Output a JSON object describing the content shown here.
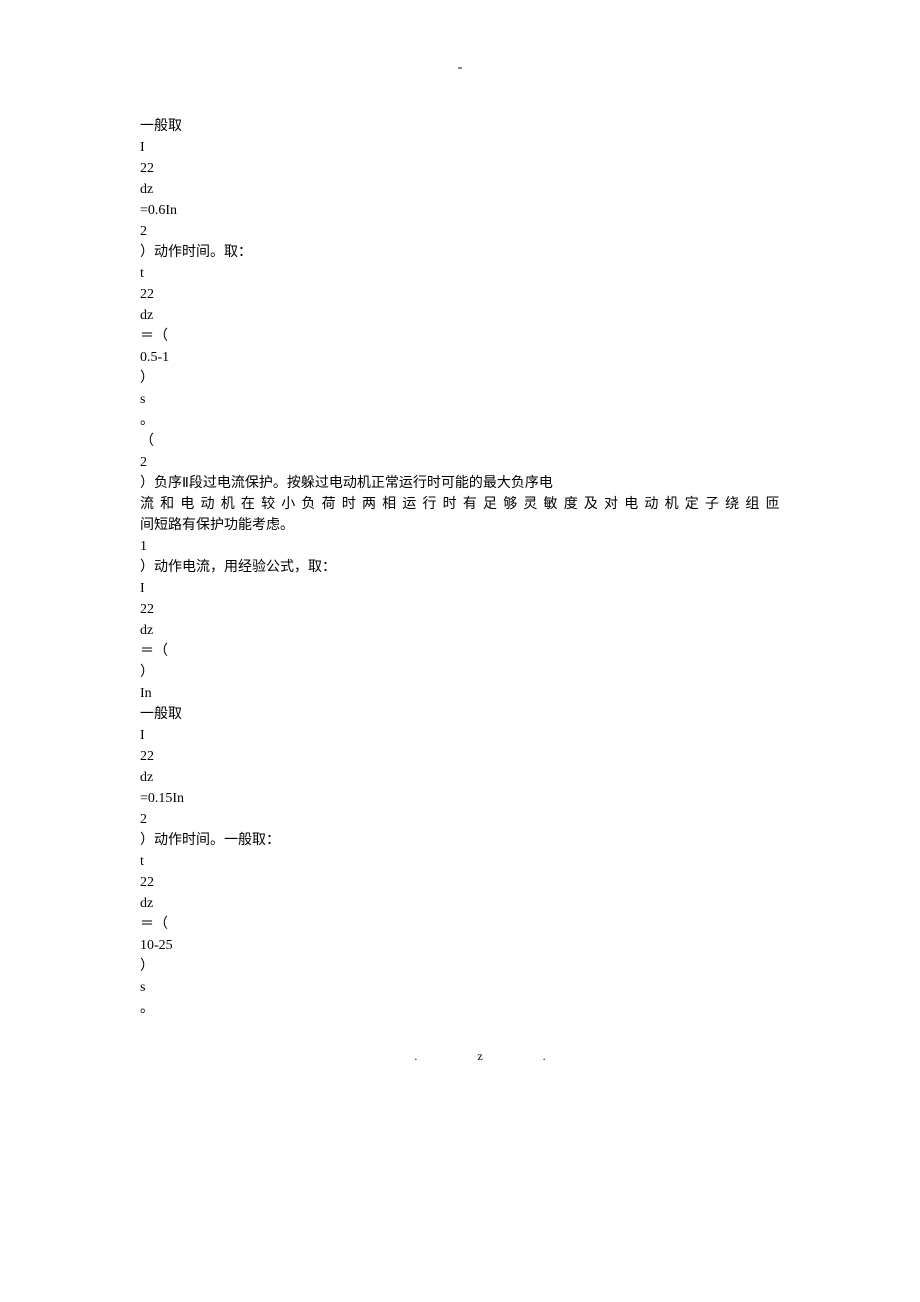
{
  "topDash": "-",
  "lines": [
    {
      "text": "一般取",
      "justified": false
    },
    {
      "text": "I",
      "justified": false
    },
    {
      "text": "22",
      "justified": false
    },
    {
      "text": "dz",
      "justified": false
    },
    {
      "text": "=0.6In",
      "justified": false
    },
    {
      "text": "2",
      "justified": false
    },
    {
      "text": "）动作时间。取：",
      "justified": false
    },
    {
      "text": "t",
      "justified": false
    },
    {
      "text": "22",
      "justified": false
    },
    {
      "text": "dz",
      "justified": false
    },
    {
      "text": "＝（",
      "justified": false
    },
    {
      "text": "0.5-1",
      "justified": false
    },
    {
      "text": "）",
      "justified": false
    },
    {
      "text": "s",
      "justified": false
    },
    {
      "text": "。",
      "justified": false
    },
    {
      "text": "（",
      "justified": false
    },
    {
      "text": "2",
      "justified": false
    },
    {
      "text": "）负序Ⅱ段过电流保护。按躲过电动机正常运行时可能的最大负序电",
      "justified": false
    },
    {
      "text": "流和电动机在较小负荷时两相运行时有足够灵敏度及对电动机定子绕组匝",
      "justified": true
    },
    {
      "text": "间短路有保护功能考虑。",
      "justified": false
    },
    {
      "text": "1",
      "justified": false
    },
    {
      "text": "）动作电流，用经验公式，取：",
      "justified": false
    },
    {
      "text": "I",
      "justified": false
    },
    {
      "text": "22",
      "justified": false
    },
    {
      "text": "dz",
      "justified": false
    },
    {
      "text": "＝（",
      "justified": false
    },
    {
      "text": "）",
      "justified": false
    },
    {
      "text": "In",
      "justified": false
    },
    {
      "text": "一般取",
      "justified": false
    },
    {
      "text": "I",
      "justified": false
    },
    {
      "text": "22",
      "justified": false
    },
    {
      "text": "dz",
      "justified": false
    },
    {
      "text": "=0.15In",
      "justified": false
    },
    {
      "text": "2",
      "justified": false
    },
    {
      "text": "）动作时间。一般取：",
      "justified": false
    },
    {
      "text": "t",
      "justified": false
    },
    {
      "text": "22",
      "justified": false
    },
    {
      "text": "dz",
      "justified": false
    },
    {
      "text": "＝（",
      "justified": false
    },
    {
      "text": "10-25",
      "justified": false
    },
    {
      "text": "）",
      "justified": false
    },
    {
      "text": "s",
      "justified": false
    },
    {
      "text": "。",
      "justified": false
    }
  ],
  "footer": {
    "left": ".",
    "right": "z."
  }
}
